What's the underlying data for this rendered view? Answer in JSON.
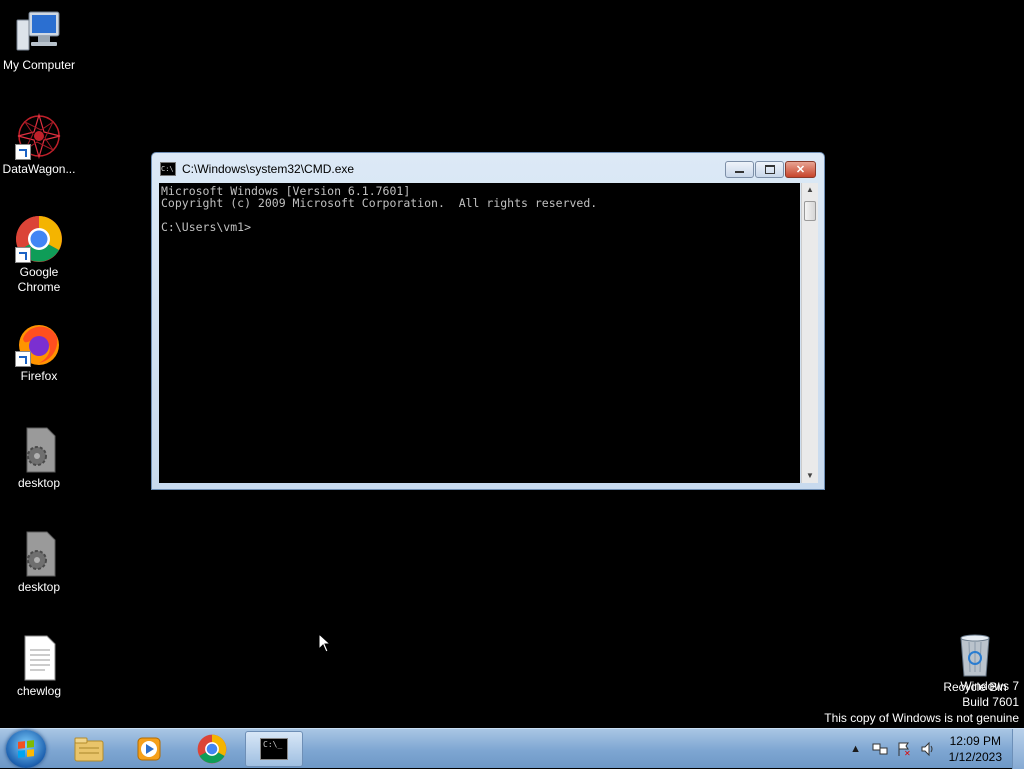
{
  "desktop_icons": [
    {
      "label": "My Computer",
      "icon": "computer-icon"
    },
    {
      "label": "DataWagon...",
      "icon": "datawagon-icon"
    },
    {
      "label": "Google Chrome",
      "icon": "chrome-icon"
    },
    {
      "label": "Firefox",
      "icon": "firefox-icon"
    },
    {
      "label": "desktop",
      "icon": "settings-file-icon"
    },
    {
      "label": "desktop",
      "icon": "settings-file-icon"
    },
    {
      "label": "chewlog",
      "icon": "text-file-icon"
    },
    {
      "label": "Recycle Bin",
      "icon": "recycle-bin-icon"
    }
  ],
  "cmd_window": {
    "title": "C:\\Windows\\system32\\CMD.exe",
    "console_lines": [
      "Microsoft Windows [Version 6.1.7601]",
      "Copyright (c) 2009 Microsoft Corporation.  All rights reserved.",
      "",
      "C:\\Users\\vm1>"
    ],
    "buttons": {
      "minimize": "minimize-icon",
      "restore": "restore-icon",
      "close": "close-icon"
    }
  },
  "watermark": {
    "line1": "Windows 7",
    "line2": "Build 7601",
    "line3": "This copy of Windows is not genuine"
  },
  "taskbar": {
    "items": [
      "start-button",
      "explorer",
      "media-player",
      "chrome",
      "cmd"
    ],
    "active": "cmd",
    "clock_time": "12:09 PM",
    "clock_date": "1/12/2023"
  },
  "colors": {
    "desktop_bg": "#000000",
    "taskbar": "#7ea6d2",
    "console_text": "#c0c0c0"
  }
}
